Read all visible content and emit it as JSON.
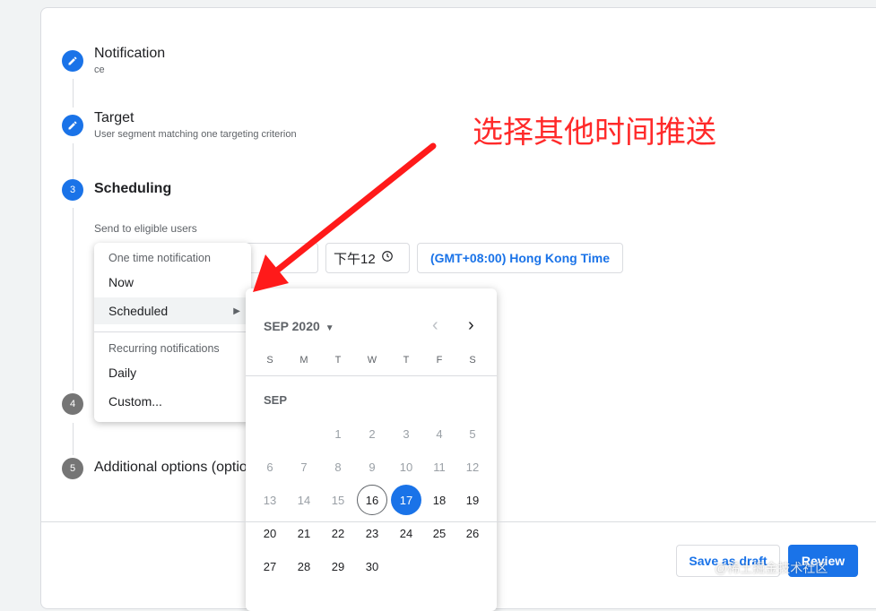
{
  "steps": [
    {
      "number": "",
      "title": "Notification",
      "subtitle": "ce"
    },
    {
      "number": "",
      "title": "Target",
      "subtitle": "User segment matching one targeting criterion"
    },
    {
      "number": "3",
      "title": "Scheduling",
      "field_label": "Send to eligible users"
    },
    {
      "number": "4",
      "title": ""
    },
    {
      "number": "5",
      "title": "Additional options (optio"
    }
  ],
  "schedule": {
    "time_value": "下午12",
    "timezone": "(GMT+08:00) Hong Kong Time"
  },
  "menu": {
    "one_time_header": "One time notification",
    "now": "Now",
    "scheduled": "Scheduled",
    "recurring_header": "Recurring notifications",
    "daily": "Daily",
    "custom": "Custom..."
  },
  "calendar": {
    "month_label": "SEP 2020",
    "section_label": "SEP",
    "weekdays": [
      "S",
      "M",
      "T",
      "W",
      "T",
      "F",
      "S"
    ],
    "first_weekday_index": 2,
    "days_in_month": 30,
    "today": 16,
    "selected": 17
  },
  "buttons": {
    "save_draft": "Save as draft",
    "review": "Review"
  },
  "annotation": {
    "text": "选择其他时间推送",
    "color": "#ff2a2a"
  },
  "watermark": "@稀土掘金技术社区",
  "colors": {
    "accent": "#1a73e8"
  }
}
